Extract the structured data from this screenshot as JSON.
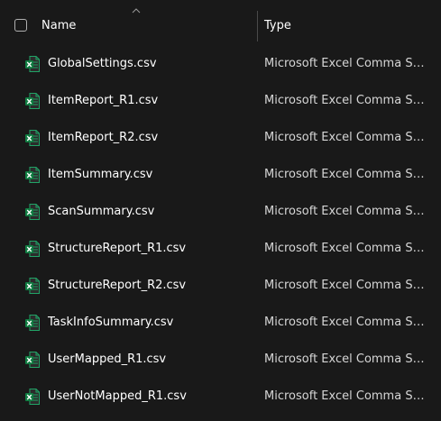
{
  "header": {
    "name_label": "Name",
    "type_label": "Type"
  },
  "files": [
    {
      "name": "GlobalSettings.csv",
      "type": "Microsoft Excel Comma Separated Values File"
    },
    {
      "name": "ItemReport_R1.csv",
      "type": "Microsoft Excel Comma Separated Values File"
    },
    {
      "name": "ItemReport_R2.csv",
      "type": "Microsoft Excel Comma Separated Values File"
    },
    {
      "name": "ItemSummary.csv",
      "type": "Microsoft Excel Comma Separated Values File"
    },
    {
      "name": "ScanSummary.csv",
      "type": "Microsoft Excel Comma Separated Values File"
    },
    {
      "name": "StructureReport_R1.csv",
      "type": "Microsoft Excel Comma Separated Values File"
    },
    {
      "name": "StructureReport_R2.csv",
      "type": "Microsoft Excel Comma Separated Values File"
    },
    {
      "name": "TaskInfoSummary.csv",
      "type": "Microsoft Excel Comma Separated Values File"
    },
    {
      "name": "UserMapped_R1.csv",
      "type": "Microsoft Excel Comma Separated Values File"
    },
    {
      "name": "UserNotMapped_R1.csv",
      "type": "Microsoft Excel Comma Separated Values File"
    }
  ],
  "icons": {
    "file_icon": "excel-csv-file-icon",
    "sort_icon": "sort-ascending-chevron-icon"
  },
  "colors": {
    "background": "#191919",
    "excel_green": "#21a366"
  }
}
